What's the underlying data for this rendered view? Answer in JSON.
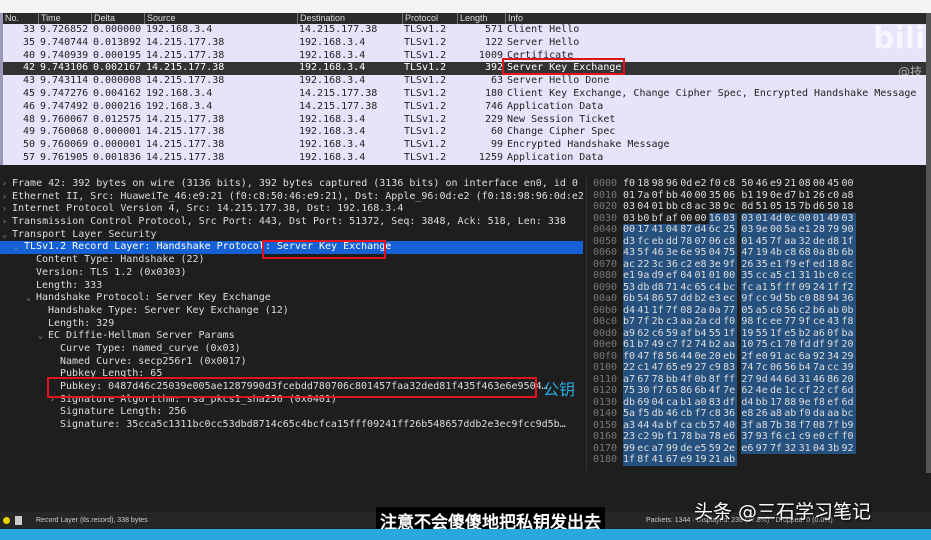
{
  "packet_list": {
    "columns": [
      "No.",
      "Time",
      "Delta",
      "Source",
      "Destination",
      "Protocol",
      "Length",
      "Info"
    ],
    "rows": [
      {
        "no": "33",
        "time": "9.726852",
        "delta": "0.000000",
        "src": "192.168.3.4",
        "dst": "14.215.177.38",
        "proto": "TLSv1.2",
        "len": "571",
        "info": "Client Hello"
      },
      {
        "no": "35",
        "time": "9.740744",
        "delta": "0.013892",
        "src": "14.215.177.38",
        "dst": "192.168.3.4",
        "proto": "TLSv1.2",
        "len": "122",
        "info": "Server Hello"
      },
      {
        "no": "40",
        "time": "9.740939",
        "delta": "0.000195",
        "src": "14.215.177.38",
        "dst": "192.168.3.4",
        "proto": "TLSv1.2",
        "len": "1009",
        "info": "Certificate"
      },
      {
        "no": "42",
        "time": "9.743106",
        "delta": "0.002167",
        "src": "14.215.177.38",
        "dst": "192.168.3.4",
        "proto": "TLSv1.2",
        "len": "392",
        "info": "Server Key Exchange"
      },
      {
        "no": "43",
        "time": "9.743114",
        "delta": "0.000008",
        "src": "14.215.177.38",
        "dst": "192.168.3.4",
        "proto": "TLSv1.2",
        "len": "63",
        "info": "Server Hello Done"
      },
      {
        "no": "45",
        "time": "9.747276",
        "delta": "0.004162",
        "src": "192.168.3.4",
        "dst": "14.215.177.38",
        "proto": "TLSv1.2",
        "len": "180",
        "info": "Client Key Exchange, Change Cipher Spec, Encrypted Handshake Message"
      },
      {
        "no": "46",
        "time": "9.747492",
        "delta": "0.000216",
        "src": "192.168.3.4",
        "dst": "14.215.177.38",
        "proto": "TLSv1.2",
        "len": "746",
        "info": "Application Data"
      },
      {
        "no": "48",
        "time": "9.760067",
        "delta": "0.012575",
        "src": "14.215.177.38",
        "dst": "192.168.3.4",
        "proto": "TLSv1.2",
        "len": "229",
        "info": "New Session Ticket"
      },
      {
        "no": "49",
        "time": "9.760068",
        "delta": "0.000001",
        "src": "14.215.177.38",
        "dst": "192.168.3.4",
        "proto": "TLSv1.2",
        "len": "60",
        "info": "Change Cipher Spec"
      },
      {
        "no": "50",
        "time": "9.760069",
        "delta": "0.000001",
        "src": "14.215.177.38",
        "dst": "192.168.3.4",
        "proto": "TLSv1.2",
        "len": "99",
        "info": "Encrypted Handshake Message"
      },
      {
        "no": "57",
        "time": "9.761905",
        "delta": "0.001836",
        "src": "14.215.177.38",
        "dst": "192.168.3.4",
        "proto": "TLSv1.2",
        "len": "1259",
        "info": "Application Data"
      }
    ],
    "selected_index": 3
  },
  "details": [
    {
      "text": "Frame 42: 392 bytes on wire (3136 bits), 392 bytes captured (3136 bits) on interface en0, id 0",
      "indent": 0,
      "arrow": "›"
    },
    {
      "text": "Ethernet II, Src: HuaweiTe_46:e9:21 (f0:c8:50:46:e9:21), Dst: Apple_96:0d:e2 (f0:18:98:96:0d:e2)",
      "indent": 0,
      "arrow": "›"
    },
    {
      "text": "Internet Protocol Version 4, Src: 14.215.177.38, Dst: 192.168.3.4",
      "indent": 0,
      "arrow": "›"
    },
    {
      "text": "Transmission Control Protocol, Src Port: 443, Dst Port: 51372, Seq: 3848, Ack: 518, Len: 338",
      "indent": 0,
      "arrow": "›"
    },
    {
      "text": "Transport Layer Security",
      "indent": 0,
      "arrow": "⌄"
    },
    {
      "text": "TLSv1.2 Record Layer: Handshake Protocol: Server Key Exchange",
      "indent": 1,
      "arrow": "⌄",
      "selected": true
    },
    {
      "text": "Content Type: Handshake (22)",
      "indent": 2,
      "arrow": ""
    },
    {
      "text": "Version: TLS 1.2 (0x0303)",
      "indent": 2,
      "arrow": ""
    },
    {
      "text": "Length: 333",
      "indent": 2,
      "arrow": ""
    },
    {
      "text": "Handshake Protocol: Server Key Exchange",
      "indent": 2,
      "arrow": "⌄"
    },
    {
      "text": "Handshake Type: Server Key Exchange (12)",
      "indent": 3,
      "arrow": ""
    },
    {
      "text": "Length: 329",
      "indent": 3,
      "arrow": ""
    },
    {
      "text": "EC Diffie-Hellman Server Params",
      "indent": 3,
      "arrow": "⌄"
    },
    {
      "text": "Curve Type: named_curve (0x03)",
      "indent": 4,
      "arrow": ""
    },
    {
      "text": "Named Curve: secp256r1 (0x0017)",
      "indent": 4,
      "arrow": ""
    },
    {
      "text": "Pubkey Length: 65",
      "indent": 4,
      "arrow": ""
    },
    {
      "text": "Pubkey: 0487d46c25039e005ae1287990d3fcebdd780706c801457faa32ded81f435f463e6e9504…",
      "indent": 4,
      "arrow": ""
    },
    {
      "text": "Signature Algorithm: rsa_pkcs1_sha256 (0x0401)",
      "indent": 4,
      "arrow": "›"
    },
    {
      "text": "Signature Length: 256",
      "indent": 4,
      "arrow": ""
    },
    {
      "text": "Signature: 35cca5c1311bc0cc53dbd8714c65c4bcfca15fff09241ff26b548657ddb2e3ec9fcc9d5b…",
      "indent": 4,
      "arrow": ""
    }
  ],
  "hex": {
    "highlight_start": 54,
    "lines": [
      [
        "0000",
        "f0 18 98 96 0d e2 f0 c8 50 46 e9 21 08 00 45 00"
      ],
      [
        "0010",
        "01 7a 0f bb 40 00 35 06 b1 19 0e d7 b1 26 c0 a8"
      ],
      [
        "0020",
        "03 04 01 bb c8 ac 38 9c 8d 51 05 15 7b d6 50 18"
      ],
      [
        "0030",
        "03 b0 bf af 00 00 16 03 03 01 4d 0c 00 01 49 03"
      ],
      [
        "0040",
        "00 17 41 04 87 d4 6c 25 03 9e 00 5a e1 28 79 90"
      ],
      [
        "0050",
        "d3 fc eb dd 78 07 06 c8 01 45 7f aa 32 de d8 1f"
      ],
      [
        "0060",
        "43 5f 46 3e 6e 95 04 75 47 19 4b c8 68 0a 8b 6b"
      ],
      [
        "0070",
        "ac 22 3c 36 c2 e8 3e 9f 26 35 e1 f9 ef ed 18 8c"
      ],
      [
        "0080",
        "e1 9a d9 ef 04 01 01 00 35 cc a5 c1 31 1b c0 cc"
      ],
      [
        "0090",
        "53 db d8 71 4c 65 c4 bc fc a1 5f ff 09 24 1f f2"
      ],
      [
        "00a0",
        "6b 54 86 57 dd b2 e3 ec 9f cc 9d 5b c0 88 94 36"
      ],
      [
        "00b0",
        "d4 41 1f 7f 08 2a 0a 77 05 a5 c0 56 c2 b6 ab 0b"
      ],
      [
        "00c0",
        "b7 7f 2b c3 aa 2a cd f0 98 fc ee 77 9f ce 43 f8"
      ],
      [
        "00d0",
        "a9 62 c6 59 af b4 55 1f 19 55 1f e5 b2 a6 0f ba"
      ],
      [
        "00e0",
        "61 b7 49 c7 f2 74 b2 aa 10 75 c1 70 fd df 9f 20"
      ],
      [
        "00f0",
        "f0 47 f8 56 44 0e 20 eb 2f e0 91 ac 6a 92 34 29"
      ],
      [
        "0100",
        "22 c1 47 65 e9 27 c9 83 74 7c 06 56 b4 7a cc 39"
      ],
      [
        "0110",
        "a7 67 78 bb 4f 0b 8f ff 27 9d 44 6d 31 46 86 20"
      ],
      [
        "0120",
        "75 30 f7 65 86 6b 4f 7e 62 4e de 1c cf 22 cf 6d"
      ],
      [
        "0130",
        "db 69 04 ca b1 a0 83 df d4 bb 17 88 9e f8 ef 6d"
      ],
      [
        "0140",
        "5a f5 db 46 cb f7 c8 36 e8 26 a8 ab f0 da aa bc"
      ],
      [
        "0150",
        "a3 44 4a bf ca cb 57 40 3f a8 7b 38 f7 08 7f b9"
      ],
      [
        "0160",
        "23 c2 9b f1 78 ba 78 e6 37 93 f6 c1 c9 e0 cf f0"
      ],
      [
        "0170",
        "99 ec a7 99 de e5 59 2e e6 97 7f 32 31 04 3b 92"
      ],
      [
        "0180",
        "1f 8f 41 67 e9 19 21 ab"
      ]
    ]
  },
  "status": {
    "field": "Record Layer (tls.record), 338 bytes",
    "packets": "Packets: 1344 · Displayed: 239 (17.8%) · Dropped: 0 (0.0%)"
  },
  "annotations": {
    "pubkey_label": "公钥",
    "subtitle": "注意不会傻傻地把私钥发出去",
    "watermark": "头条 @三石学习笔记",
    "bili_watermark": "bilib",
    "at_watermark": "@技"
  },
  "colors": {
    "highlight_box": "#e0141e",
    "selected_detail": "#1560d4",
    "list_bg": "#e6e4fb",
    "hex_highlight": "#26517f"
  }
}
